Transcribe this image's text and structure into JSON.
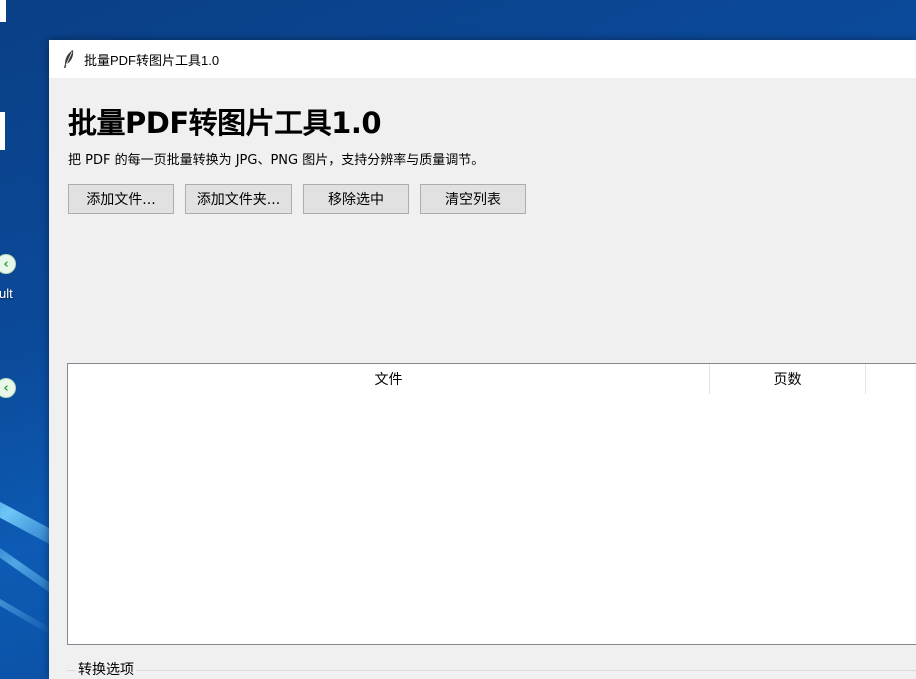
{
  "desktop": {
    "icon_labels": [
      "ult"
    ]
  },
  "window": {
    "title": "批量PDF转图片工具1.0"
  },
  "app": {
    "heading": "批量PDF转图片工具1.0",
    "description": "把 PDF 的每一页批量转换为 JPG、PNG 图片，支持分辨率与质量调节。"
  },
  "toolbar": {
    "add_files": "添加文件...",
    "add_folder": "添加文件夹...",
    "remove_selected": "移除选中",
    "clear_list": "清空列表"
  },
  "table": {
    "columns": [
      "文件",
      "页数"
    ],
    "rows": []
  },
  "options": {
    "label": "转换选项"
  },
  "colors": {
    "window_bg": "#f0f0f0",
    "button_bg": "#e1e1e1",
    "button_border": "#adadad"
  }
}
